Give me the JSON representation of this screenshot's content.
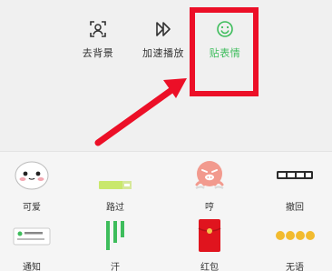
{
  "toolbar": {
    "items": [
      {
        "label": "去背景",
        "icon": "person-frame-icon"
      },
      {
        "label": "加速播放",
        "icon": "fast-forward-icon"
      },
      {
        "label": "贴表情",
        "icon": "smiley-icon",
        "active": true
      }
    ]
  },
  "stickers": {
    "row1": [
      {
        "label": "可爱"
      },
      {
        "label": "路过"
      },
      {
        "label": "哼"
      },
      {
        "label": "撤回"
      }
    ],
    "row2": [
      {
        "label": "通知"
      },
      {
        "label": "汗"
      },
      {
        "label": "红包"
      },
      {
        "label": "无语"
      }
    ]
  },
  "colors": {
    "accent_green": "#3ebd5c",
    "highlight_red": "#ec0f27",
    "panel_bg": "#f5f5f5"
  }
}
